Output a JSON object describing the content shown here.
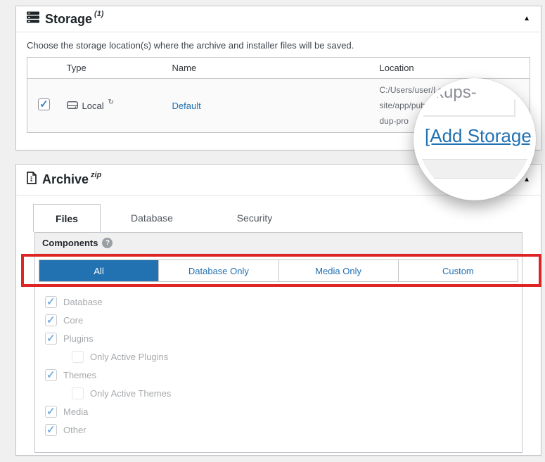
{
  "colors": {
    "accent_blue": "#2271b1",
    "annotation_red": "#df2424",
    "page_bg": "#f0f0f1",
    "panel_border": "#c3c4c7",
    "disabled_text": "#a7aaad"
  },
  "storage": {
    "title": "Storage",
    "count_sup": "(1)",
    "collapse_icon": "▲",
    "description": "Choose the storage location(s) where the archive and installer files will be saved.",
    "table": {
      "headers": [
        "Type",
        "Name",
        "Location"
      ],
      "row": {
        "checked": true,
        "type": "Local",
        "type_sup": "↻",
        "name": "Default",
        "location_lines": [
          "C:/Users/user/Local",
          "site/app/public/w",
          "dup-pro"
        ]
      }
    },
    "add_storage": "[Add Storage]"
  },
  "magnifier": {
    "path_fragment": "ckups-",
    "link": "[Add Storage]"
  },
  "archive": {
    "title": "Archive",
    "format_sup": "zip",
    "collapse_icon": "▲",
    "tabs": [
      {
        "label": "Files",
        "active": true
      },
      {
        "label": "Database",
        "active": false
      },
      {
        "label": "Security",
        "active": false
      }
    ],
    "components": {
      "label": "Components",
      "help_icon": "?",
      "modes": [
        {
          "label": "All",
          "active": true
        },
        {
          "label": "Database Only",
          "active": false
        },
        {
          "label": "Media Only",
          "active": false
        },
        {
          "label": "Custom",
          "active": false
        }
      ],
      "items": [
        {
          "label": "Database",
          "checked": true,
          "indent": false
        },
        {
          "label": "Core",
          "checked": true,
          "indent": false
        },
        {
          "label": "Plugins",
          "checked": true,
          "indent": false
        },
        {
          "label": "Only Active Plugins",
          "checked": false,
          "indent": true
        },
        {
          "label": "Themes",
          "checked": true,
          "indent": false
        },
        {
          "label": "Only Active Themes",
          "checked": false,
          "indent": true
        },
        {
          "label": "Media",
          "checked": true,
          "indent": false
        },
        {
          "label": "Other",
          "checked": true,
          "indent": false
        }
      ]
    }
  }
}
